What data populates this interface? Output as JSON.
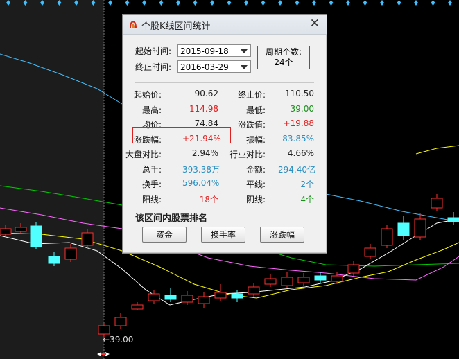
{
  "window": {
    "title": "个股K线区间统计",
    "close_icon": "close-icon",
    "logo_icon": "app-logo-icon"
  },
  "range": {
    "start_label": "起始时间:",
    "start_value": "2015-09-18",
    "end_label": "终止时间:",
    "end_value": "2016-03-29",
    "period_label": "周期个数:",
    "period_value": "24个"
  },
  "stats": {
    "rows": [
      {
        "k1": "起始价:",
        "v1": "90.62",
        "c1": "blk",
        "k2": "终止价:",
        "v2": "110.50",
        "c2": "blk"
      },
      {
        "k1": "最高:",
        "v1": "114.98",
        "c1": "red",
        "k2": "最低:",
        "v2": "39.00",
        "c2": "green"
      },
      {
        "k1": "均价:",
        "v1": "74.84",
        "c1": "blk",
        "k2": "涨跌值:",
        "v2": "+19.88",
        "c2": "red"
      },
      {
        "k1": "涨跌幅:",
        "v1": "+21.94%",
        "c1": "red",
        "k2": "振幅:",
        "v2": "83.85%",
        "c2": "blue"
      },
      {
        "k1": "大盘对比:",
        "v1": "2.94%",
        "c1": "blk",
        "k2": "行业对比:",
        "v2": "4.66%",
        "c2": "blk"
      },
      {
        "k1": "总手:",
        "v1": "393.38万",
        "c1": "blue",
        "k2": "金额:",
        "v2": "294.40亿",
        "c2": "blue"
      },
      {
        "k1": "换手:",
        "v1": "596.04%",
        "c1": "blue",
        "k2": "平线:",
        "v2": "2个",
        "c2": "blue"
      },
      {
        "k1": "阳线:",
        "v1": "18个",
        "c1": "red",
        "k2": "阴线:",
        "v2": "4个",
        "c2": "green"
      }
    ]
  },
  "ranking": {
    "title": "该区间内股票排名",
    "buttons": [
      "资金",
      "换手率",
      "涨跌幅"
    ]
  },
  "chart": {
    "low_label": "←39.00",
    "colors": {
      "up": "#ff3030",
      "down": "#50ffff",
      "ma5": "#ffffff",
      "ma10": "#ffff00",
      "ma20": "#ff66ff",
      "ma60": "#00cc00",
      "ma120": "#40c0ff",
      "marker": "#40c0ff"
    }
  }
}
